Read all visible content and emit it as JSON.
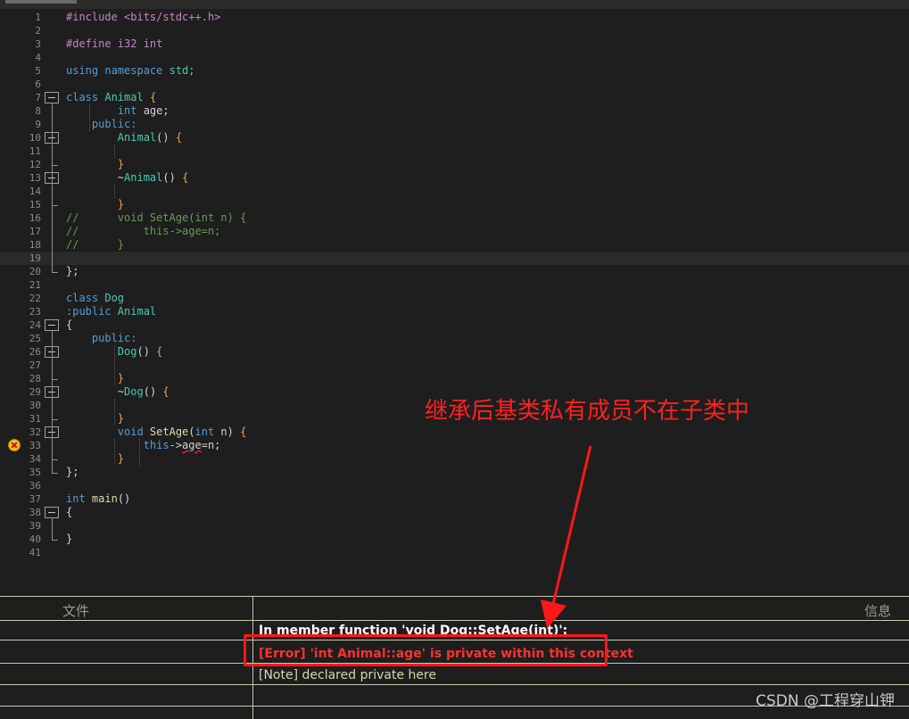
{
  "editor": {
    "lines": [
      {
        "n": "1",
        "code": [
          {
            "t": "#include <bits/stdc++.h>",
            "c": "pp"
          }
        ]
      },
      {
        "n": "2",
        "code": []
      },
      {
        "n": "3",
        "code": [
          {
            "t": "#define i32 int",
            "c": "pp"
          }
        ]
      },
      {
        "n": "4",
        "code": []
      },
      {
        "n": "5",
        "code": [
          {
            "t": "using namespace ",
            "c": "kw"
          },
          {
            "t": "std;",
            "c": "ty"
          }
        ]
      },
      {
        "n": "6",
        "code": []
      },
      {
        "n": "7",
        "code": [
          {
            "t": "class ",
            "c": "kw"
          },
          {
            "t": "Animal ",
            "c": "ty"
          },
          {
            "t": "{",
            "c": "br"
          }
        ]
      },
      {
        "n": "8",
        "code": [
          {
            "t": "        int ",
            "c": "kw"
          },
          {
            "t": "age;",
            "c": "op"
          }
        ]
      },
      {
        "n": "9",
        "code": [
          {
            "t": "    public:",
            "c": "kw"
          }
        ]
      },
      {
        "n": "10",
        "code": [
          {
            "t": "        Animal",
            "c": "ty"
          },
          {
            "t": "() ",
            "c": "op"
          },
          {
            "t": "{",
            "c": "br"
          }
        ]
      },
      {
        "n": "11",
        "code": []
      },
      {
        "n": "12",
        "code": [
          {
            "t": "        }",
            "c": "br"
          }
        ]
      },
      {
        "n": "13",
        "code": [
          {
            "t": "        ~",
            "c": "op"
          },
          {
            "t": "Animal",
            "c": "ty"
          },
          {
            "t": "() ",
            "c": "op"
          },
          {
            "t": "{",
            "c": "br"
          }
        ]
      },
      {
        "n": "14",
        "code": []
      },
      {
        "n": "15",
        "code": [
          {
            "t": "        }",
            "c": "br"
          }
        ]
      },
      {
        "n": "16",
        "code": [
          {
            "t": "//      void SetAge(int n) {",
            "c": "cm"
          }
        ]
      },
      {
        "n": "17",
        "code": [
          {
            "t": "//          this->age=n;",
            "c": "cm"
          }
        ]
      },
      {
        "n": "18",
        "code": [
          {
            "t": "//      }",
            "c": "cm"
          }
        ]
      },
      {
        "n": "19",
        "code": []
      },
      {
        "n": "20",
        "code": [
          {
            "t": "};",
            "c": "op"
          }
        ]
      },
      {
        "n": "21",
        "code": []
      },
      {
        "n": "22",
        "code": [
          {
            "t": "class ",
            "c": "kw"
          },
          {
            "t": "Dog",
            "c": "ty"
          }
        ]
      },
      {
        "n": "23",
        "code": [
          {
            "t": ":public ",
            "c": "kw"
          },
          {
            "t": "Animal",
            "c": "ty"
          }
        ]
      },
      {
        "n": "24",
        "code": [
          {
            "t": "{",
            "c": "op"
          }
        ]
      },
      {
        "n": "25",
        "code": [
          {
            "t": "    public:",
            "c": "kw"
          }
        ]
      },
      {
        "n": "26",
        "code": [
          {
            "t": "        Dog",
            "c": "ty"
          },
          {
            "t": "() ",
            "c": "op"
          },
          {
            "t": "{",
            "c": "br"
          }
        ]
      },
      {
        "n": "27",
        "code": []
      },
      {
        "n": "28",
        "code": [
          {
            "t": "        }",
            "c": "br"
          }
        ]
      },
      {
        "n": "29",
        "code": [
          {
            "t": "        ~",
            "c": "op"
          },
          {
            "t": "Dog",
            "c": "ty"
          },
          {
            "t": "() ",
            "c": "op"
          },
          {
            "t": "{",
            "c": "br"
          }
        ]
      },
      {
        "n": "30",
        "code": []
      },
      {
        "n": "31",
        "code": [
          {
            "t": "        }",
            "c": "br"
          }
        ]
      },
      {
        "n": "32",
        "code": [
          {
            "t": "        void ",
            "c": "kw"
          },
          {
            "t": "SetAge",
            "c": "fn"
          },
          {
            "t": "(",
            "c": "op"
          },
          {
            "t": "int ",
            "c": "kw"
          },
          {
            "t": "n) ",
            "c": "op"
          },
          {
            "t": "{",
            "c": "br"
          }
        ]
      },
      {
        "n": "33",
        "code": [
          {
            "t": "            this",
            "c": "kw"
          },
          {
            "t": "->",
            "c": "op"
          },
          {
            "t": "age",
            "c": "sq"
          },
          {
            "t": "=n;",
            "c": "op"
          }
        ]
      },
      {
        "n": "34",
        "code": [
          {
            "t": "        }",
            "c": "br"
          }
        ]
      },
      {
        "n": "35",
        "code": [
          {
            "t": "};",
            "c": "op"
          }
        ]
      },
      {
        "n": "36",
        "code": []
      },
      {
        "n": "37",
        "code": [
          {
            "t": "int ",
            "c": "kw"
          },
          {
            "t": "main",
            "c": "fn"
          },
          {
            "t": "()",
            "c": "op"
          }
        ]
      },
      {
        "n": "38",
        "code": [
          {
            "t": "{",
            "c": "op"
          }
        ]
      },
      {
        "n": "39",
        "code": []
      },
      {
        "n": "40",
        "code": [
          {
            "t": "}",
            "c": "op"
          }
        ]
      },
      {
        "n": "41",
        "code": []
      }
    ],
    "current_line": "19",
    "error_line": "33",
    "fold_lines": [
      "7",
      "10",
      "13",
      "24",
      "26",
      "29",
      "32",
      "38"
    ]
  },
  "annotation": {
    "text": "继承后基类私有成员不在子类中",
    "color": "#ff2020"
  },
  "messages": {
    "header_file": "文件",
    "header_info": "信息",
    "rows": [
      {
        "kind": "context",
        "text": "In member function 'void Dog::SetAge(int)':"
      },
      {
        "kind": "error",
        "text": "[Error] 'int Animal::age' is private within this context"
      },
      {
        "kind": "note",
        "text": "[Note] declared private here"
      }
    ]
  },
  "watermark": "CSDN @工程穿山钾"
}
